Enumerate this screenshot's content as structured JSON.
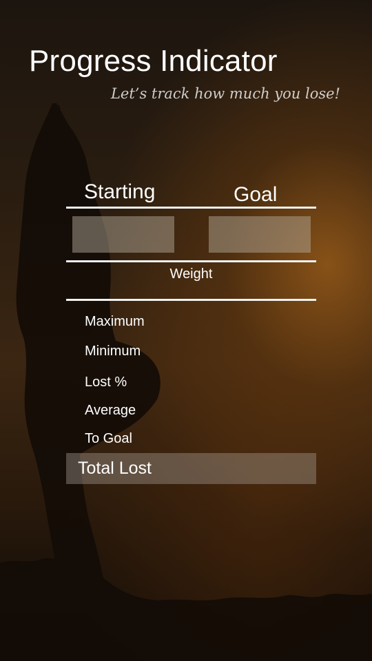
{
  "header": {
    "title": "Progress Indicator",
    "subtitle": "Let’s track how much you lose!"
  },
  "columns": {
    "starting": "Starting",
    "goal": "Goal"
  },
  "inputs": {
    "starting_value": "",
    "goal_value": ""
  },
  "weight_label": "Weight",
  "stats": {
    "maximum": "Maximum",
    "minimum": "Minimum",
    "lost_percent": "Lost %",
    "average": "Average",
    "to_goal": "To Goal"
  },
  "total_lost": "Total Lost",
  "colors": {
    "text": "#ffffff",
    "sunset_accent": "#965a19",
    "field_fill": "#afa596"
  }
}
